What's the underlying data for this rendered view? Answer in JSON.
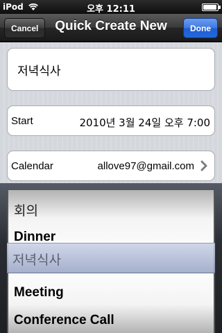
{
  "status": {
    "carrier": "iPod",
    "time": "오후 12:11",
    "battery_level": 0.95
  },
  "nav": {
    "title": "Quick Create New",
    "cancel_label": "Cancel",
    "done_label": "Done"
  },
  "form": {
    "title_value": "저녁식사",
    "start_label": "Start",
    "start_value": "2010년 3월 24일 오후 7:00",
    "calendar_label": "Calendar",
    "calendar_value": "allove97@gmail.com"
  },
  "picker": {
    "rows": [
      "회의",
      "Dinner",
      "저녁식사",
      "Meeting",
      "Conference Call"
    ],
    "selected": "저녁식사"
  }
}
